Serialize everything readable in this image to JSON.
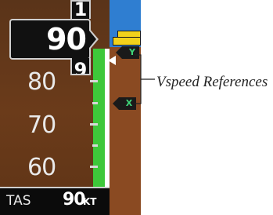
{
  "airspeed_tape": {
    "current_reading": "90",
    "roll_digit_above": "1",
    "roll_digit_below": "9",
    "tick_labels": [
      "80",
      "70",
      "60"
    ]
  },
  "vspeed_bugs": [
    {
      "label": "Y"
    },
    {
      "label": "X"
    }
  ],
  "true_airspeed": {
    "label": "TAS",
    "value": "90",
    "unit": "KT"
  },
  "callout": {
    "label": "Vspeed References"
  },
  "colors": {
    "sky": "#2f7ed1",
    "ground": "#8a4a22",
    "green_band": "#3ec83a",
    "bug_text": "#3fd67a",
    "attitude_marker": "#f2d21b"
  }
}
